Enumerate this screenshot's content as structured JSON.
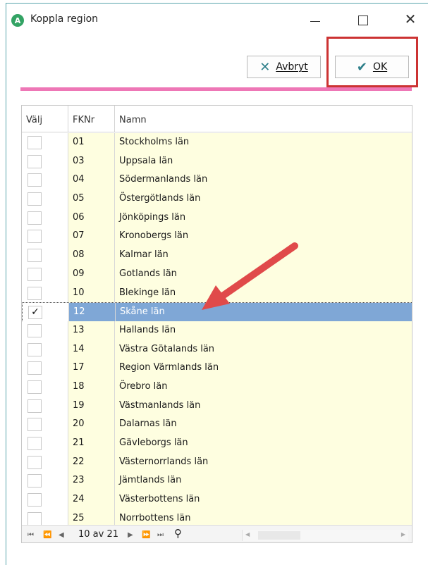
{
  "window": {
    "app_icon_letter": "A",
    "title": "Koppla region",
    "close_glyph": "✕"
  },
  "toolbar": {
    "cancel_label": "Avbryt",
    "cancel_icon": "x-icon",
    "ok_label": "OK",
    "ok_icon": "checkmark-icon",
    "accent_color": "#2e7f8a",
    "separator_color": "#ee77b6",
    "highlight_color": "#cc3333"
  },
  "grid": {
    "columns": [
      "Välj",
      "FKNr",
      "Namn"
    ],
    "rows": [
      {
        "checked": false,
        "fknr": "01",
        "namn": "Stockholms län"
      },
      {
        "checked": false,
        "fknr": "03",
        "namn": "Uppsala län"
      },
      {
        "checked": false,
        "fknr": "04",
        "namn": "Södermanlands län"
      },
      {
        "checked": false,
        "fknr": "05",
        "namn": "Östergötlands län"
      },
      {
        "checked": false,
        "fknr": "06",
        "namn": "Jönköpings län"
      },
      {
        "checked": false,
        "fknr": "07",
        "namn": "Kronobergs län"
      },
      {
        "checked": false,
        "fknr": "08",
        "namn": "Kalmar län"
      },
      {
        "checked": false,
        "fknr": "09",
        "namn": "Gotlands län"
      },
      {
        "checked": false,
        "fknr": "10",
        "namn": "Blekinge län"
      },
      {
        "checked": true,
        "fknr": "12",
        "namn": "Skåne län",
        "selected": true
      },
      {
        "checked": false,
        "fknr": "13",
        "namn": "Hallands län"
      },
      {
        "checked": false,
        "fknr": "14",
        "namn": "Västra Götalands län"
      },
      {
        "checked": false,
        "fknr": "17",
        "namn": "Region Värmlands län"
      },
      {
        "checked": false,
        "fknr": "18",
        "namn": "Örebro län"
      },
      {
        "checked": false,
        "fknr": "19",
        "namn": "Västmanlands län"
      },
      {
        "checked": false,
        "fknr": "20",
        "namn": "Dalarnas län"
      },
      {
        "checked": false,
        "fknr": "21",
        "namn": "Gävleborgs län"
      },
      {
        "checked": false,
        "fknr": "22",
        "namn": "Västernorrlands län"
      },
      {
        "checked": false,
        "fknr": "23",
        "namn": "Jämtlands län"
      },
      {
        "checked": false,
        "fknr": "24",
        "namn": "Västerbottens län"
      },
      {
        "checked": false,
        "fknr": "25",
        "namn": "Norrbottens län"
      }
    ],
    "selected_row_color": "#7fa7d6",
    "row_background": "#fefee0"
  },
  "pager": {
    "position_text": "10 av 21",
    "search_icon": "magnifier-icon"
  },
  "annotation": {
    "arrow_color": "#e04a4a"
  }
}
